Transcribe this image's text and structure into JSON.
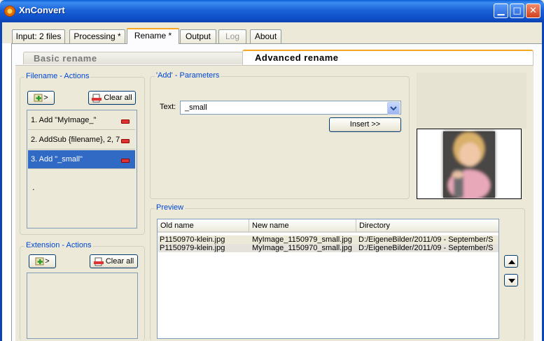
{
  "window": {
    "title": "XnConvert"
  },
  "tabs": [
    {
      "label": "Input: 2 files"
    },
    {
      "label": "Processing *"
    },
    {
      "label": "Rename *"
    },
    {
      "label": "Output"
    },
    {
      "label": "Log"
    },
    {
      "label": "About"
    }
  ],
  "subtabs": {
    "basic": "Basic rename",
    "advanced": "Advanced rename"
  },
  "filename_actions": {
    "legend": "Filename - Actions",
    "add_label": ">",
    "clear_label": "Clear all",
    "items": [
      {
        "label": "1. Add \"MyImage_\""
      },
      {
        "label": "2. AddSub {filename}, 2, 7"
      },
      {
        "label": "3. Add \"_small\""
      }
    ],
    "footer_dot": "."
  },
  "extension_actions": {
    "legend": "Extension - Actions",
    "add_label": ">",
    "clear_label": "Clear all"
  },
  "parameters": {
    "legend": "'Add' - Parameters",
    "text_label": "Text:",
    "text_value": "_small",
    "insert_label": "Insert >>"
  },
  "preview": {
    "legend": "Preview",
    "columns": [
      "Old name",
      "New name",
      "Directory"
    ],
    "rows": [
      [
        "P1150970-klein.jpg",
        "MyImage_1150979_small.jpg",
        "D:/EigeneBilder/2011/09 - September/S"
      ],
      [
        "P1150979-klein.jpg",
        "MyImage_1150970_small.jpg",
        "D:/EigeneBilder/2011/09 - September/S"
      ]
    ]
  },
  "colors": {
    "accent_tab": "#f5a623",
    "selection": "#316ac5",
    "legend_text": "#0046d5"
  }
}
